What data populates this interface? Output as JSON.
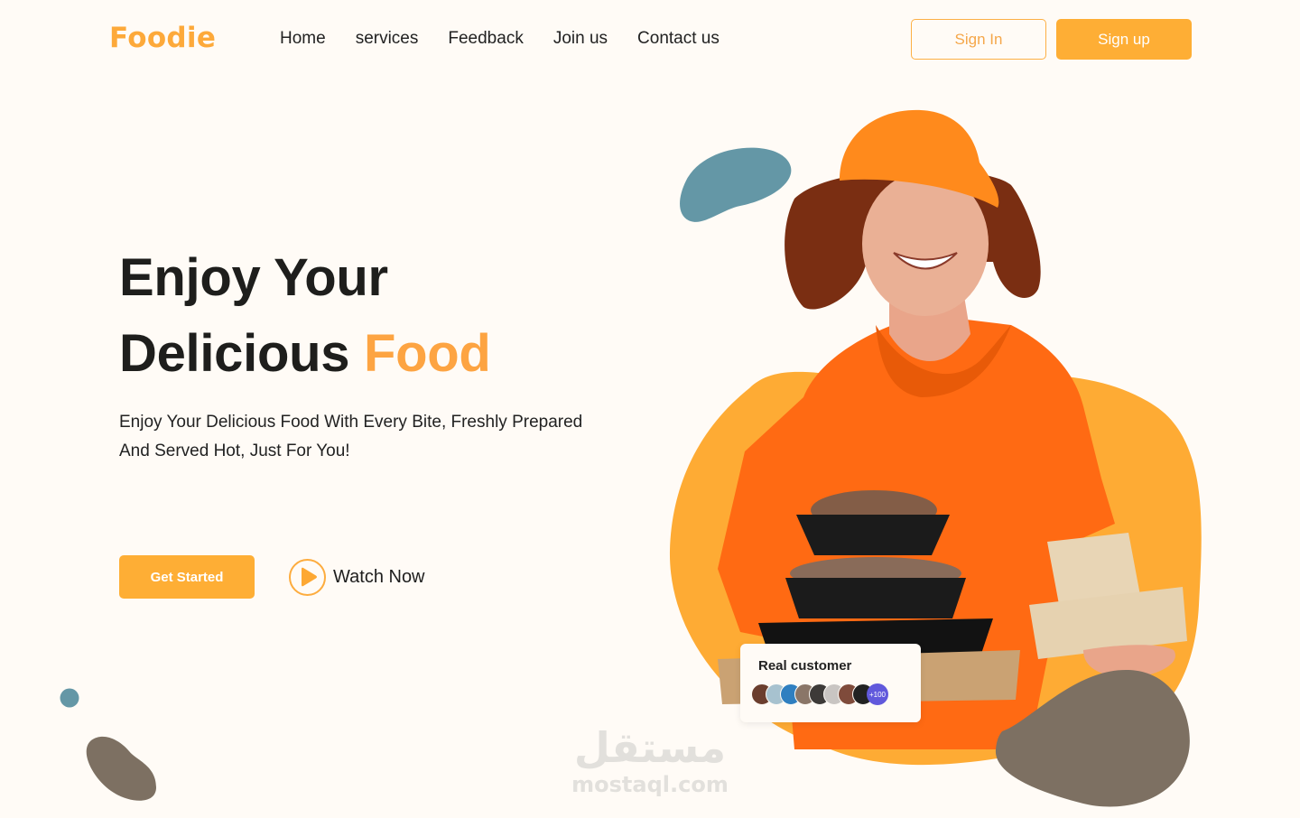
{
  "brand": {
    "logo": "Foodie",
    "accent": "#fda93a",
    "button": "#feae35"
  },
  "nav": {
    "links": [
      "Home",
      "services",
      "Feedback",
      "Join us",
      "Contact us"
    ],
    "sign_in": "Sign In",
    "sign_up": "Sign up"
  },
  "hero": {
    "title_line1": "Enjoy Your",
    "title_line2_plain": "Delicious ",
    "title_line2_accent": "Food",
    "description_line1": "Enjoy Your Delicious Food With Every Bite, Freshly Prepared",
    "description_line2": "And Served Hot, Just For You!",
    "cta_primary": "Get Started",
    "cta_secondary": "Watch Now",
    "cta_secondary_icon": "play-icon"
  },
  "customers_card": {
    "title": "Real customer",
    "extra_count": "+100",
    "avatar_colors": [
      "#6b3e2e",
      "#a7c2cf",
      "#2f7fc0",
      "#8a7668",
      "#3d3a38",
      "#c9c5c2",
      "#7f4b3b",
      "#222222"
    ]
  },
  "illustration": {
    "subject": "delivery person in orange cap and polo holding food containers",
    "colors": {
      "blob_orange": "#feab34",
      "blob_teal": "#6497a6",
      "blob_brown": "#7d7062",
      "shirt": "#ff6a13"
    }
  },
  "watermark": {
    "arabic": "مستقل",
    "latin": "mostaql.com"
  }
}
